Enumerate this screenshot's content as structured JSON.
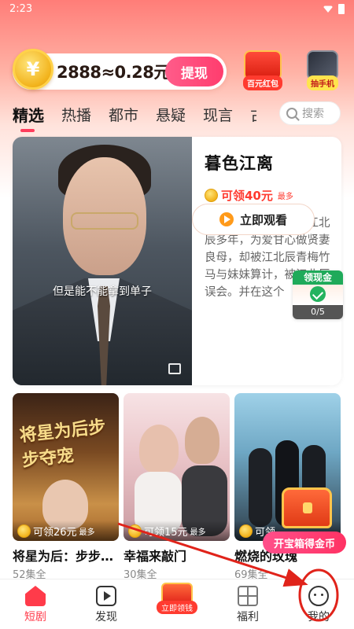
{
  "status_bar": {
    "time": "2:23"
  },
  "header": {
    "coin_summary": "2888≈0.28元",
    "withdraw_label": "提现",
    "promos": [
      {
        "label": "百元红包",
        "icon": "red-packet-icon"
      },
      {
        "label": "抽手机",
        "icon": "phone-icon"
      }
    ]
  },
  "tabs": [
    "精选",
    "热播",
    "都市",
    "悬疑",
    "现言",
    "古"
  ],
  "active_tab_index": 0,
  "search": {
    "placeholder": "搜索"
  },
  "featured": {
    "title": "暮色江离",
    "reward": "可领40元",
    "reward_suffix": "最多",
    "description": "苏清染隐姓埋名嫁给江北辰多年，为爱甘心做贤妻良母，却被江北辰青梅竹马与妹妹算计，被江北辰误会。并在这个",
    "subtitle": "但是能不能拿到单子",
    "watch_label": "立即观看"
  },
  "cash_widget": {
    "title": "领现金",
    "progress": "0/5"
  },
  "dramas": [
    {
      "title": "将星为后：步步…",
      "episodes": "52集全",
      "reward": "可领26元",
      "reward_suffix": "最多",
      "poster_text": "将星为后步步夺宠"
    },
    {
      "title": "幸福来敲门",
      "episodes": "30集全",
      "reward": "可领15元",
      "reward_suffix": "最多"
    },
    {
      "title": "燃烧的玫瑰",
      "episodes": "69集全",
      "reward": "可领",
      "reward_suffix": ""
    }
  ],
  "chest": {
    "label": "开宝箱得金币"
  },
  "bottom_nav": [
    {
      "label": "短剧",
      "icon": "home-icon",
      "active": true
    },
    {
      "label": "发现",
      "icon": "discover-icon",
      "active": false
    },
    {
      "label": "立即领钱",
      "icon": "earn-icon",
      "active": false
    },
    {
      "label": "福利",
      "icon": "welfare-icon",
      "active": false
    },
    {
      "label": "我的",
      "icon": "profile-icon",
      "active": false
    }
  ],
  "colors": {
    "accent": "#ff3b4a",
    "reward": "#ff3b30",
    "annotation": "#e0231a"
  }
}
